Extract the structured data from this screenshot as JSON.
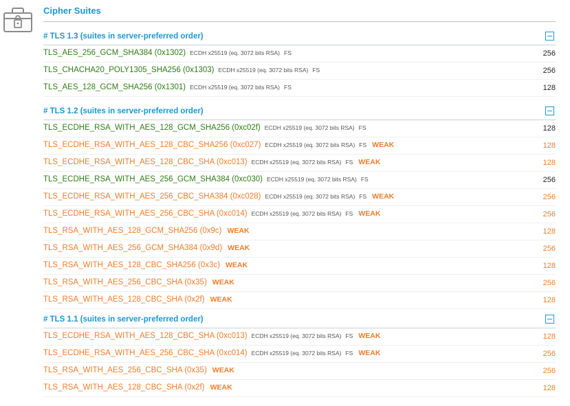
{
  "title": "Cipher Suites",
  "sections": [
    {
      "heading": "# TLS 1.3 (suites in server-preferred order)",
      "rows": [
        {
          "name": "TLS_AES_256_GCM_SHA384",
          "hex": "(0x1302)",
          "kex": "ECDH x25519 (eq. 3072 bits RSA)",
          "fs": "FS",
          "weak": "",
          "bits": "256",
          "status": "good"
        },
        {
          "name": "TLS_CHACHA20_POLY1305_SHA256",
          "hex": "(0x1303)",
          "kex": "ECDH x25519 (eq. 3072 bits RSA)",
          "fs": "FS",
          "weak": "",
          "bits": "256",
          "status": "good"
        },
        {
          "name": "TLS_AES_128_GCM_SHA256",
          "hex": "(0x1301)",
          "kex": "ECDH x25519 (eq. 3072 bits RSA)",
          "fs": "FS",
          "weak": "",
          "bits": "128",
          "status": "good"
        }
      ]
    },
    {
      "heading": "# TLS 1.2 (suites in server-preferred order)",
      "rows": [
        {
          "name": "TLS_ECDHE_RSA_WITH_AES_128_GCM_SHA256",
          "hex": "(0xc02f)",
          "kex": "ECDH x25519 (eq. 3072 bits RSA)",
          "fs": "FS",
          "weak": "",
          "bits": "128",
          "status": "good"
        },
        {
          "name": "TLS_ECDHE_RSA_WITH_AES_128_CBC_SHA256",
          "hex": "(0xc027)",
          "kex": "ECDH x25519 (eq. 3072 bits RSA)",
          "fs": "FS",
          "weak": "WEAK",
          "bits": "128",
          "status": "weak"
        },
        {
          "name": "TLS_ECDHE_RSA_WITH_AES_128_CBC_SHA",
          "hex": "(0xc013)",
          "kex": "ECDH x25519 (eq. 3072 bits RSA)",
          "fs": "FS",
          "weak": "WEAK",
          "bits": "128",
          "status": "weak"
        },
        {
          "name": "TLS_ECDHE_RSA_WITH_AES_256_GCM_SHA384",
          "hex": "(0xc030)",
          "kex": "ECDH x25519 (eq. 3072 bits RSA)",
          "fs": "FS",
          "weak": "",
          "bits": "256",
          "status": "good"
        },
        {
          "name": "TLS_ECDHE_RSA_WITH_AES_256_CBC_SHA384",
          "hex": "(0xc028)",
          "kex": "ECDH x25519 (eq. 3072 bits RSA)",
          "fs": "FS",
          "weak": "WEAK",
          "bits": "256",
          "status": "weak"
        },
        {
          "name": "TLS_ECDHE_RSA_WITH_AES_256_CBC_SHA",
          "hex": "(0xc014)",
          "kex": "ECDH x25519 (eq. 3072 bits RSA)",
          "fs": "FS",
          "weak": "WEAK",
          "bits": "256",
          "status": "weak"
        },
        {
          "name": "TLS_RSA_WITH_AES_128_GCM_SHA256",
          "hex": "(0x9c)",
          "kex": "",
          "fs": "",
          "weak": "WEAK",
          "bits": "128",
          "status": "weak"
        },
        {
          "name": "TLS_RSA_WITH_AES_256_GCM_SHA384",
          "hex": "(0x9d)",
          "kex": "",
          "fs": "",
          "weak": "WEAK",
          "bits": "256",
          "status": "weak"
        },
        {
          "name": "TLS_RSA_WITH_AES_128_CBC_SHA256",
          "hex": "(0x3c)",
          "kex": "",
          "fs": "",
          "weak": "WEAK",
          "bits": "128",
          "status": "weak"
        },
        {
          "name": "TLS_RSA_WITH_AES_256_CBC_SHA",
          "hex": "(0x35)",
          "kex": "",
          "fs": "",
          "weak": "WEAK",
          "bits": "256",
          "status": "weak"
        },
        {
          "name": "TLS_RSA_WITH_AES_128_CBC_SHA",
          "hex": "(0x2f)",
          "kex": "",
          "fs": "",
          "weak": "WEAK",
          "bits": "128",
          "status": "weak"
        }
      ]
    },
    {
      "heading": "# TLS 1.1 (suites in server-preferred order)",
      "rows": [
        {
          "name": "TLS_ECDHE_RSA_WITH_AES_128_CBC_SHA",
          "hex": "(0xc013)",
          "kex": "ECDH x25519 (eq. 3072 bits RSA)",
          "fs": "FS",
          "weak": "WEAK",
          "bits": "128",
          "status": "weak"
        },
        {
          "name": "TLS_ECDHE_RSA_WITH_AES_256_CBC_SHA",
          "hex": "(0xc014)",
          "kex": "ECDH x25519 (eq. 3072 bits RSA)",
          "fs": "FS",
          "weak": "WEAK",
          "bits": "256",
          "status": "weak"
        },
        {
          "name": "TLS_RSA_WITH_AES_256_CBC_SHA",
          "hex": "(0x35)",
          "kex": "",
          "fs": "",
          "weak": "WEAK",
          "bits": "256",
          "status": "weak"
        },
        {
          "name": "TLS_RSA_WITH_AES_128_CBC_SHA",
          "hex": "(0x2f)",
          "kex": "",
          "fs": "",
          "weak": "WEAK",
          "bits": "128",
          "status": "weak"
        }
      ]
    }
  ],
  "colors": {
    "accent": "#1d96d1",
    "good": "#2f7d14",
    "weak": "#ee7d2b"
  },
  "icons": {
    "section_icon": "lock-icon",
    "collapse": "collapse-minus-icon"
  }
}
